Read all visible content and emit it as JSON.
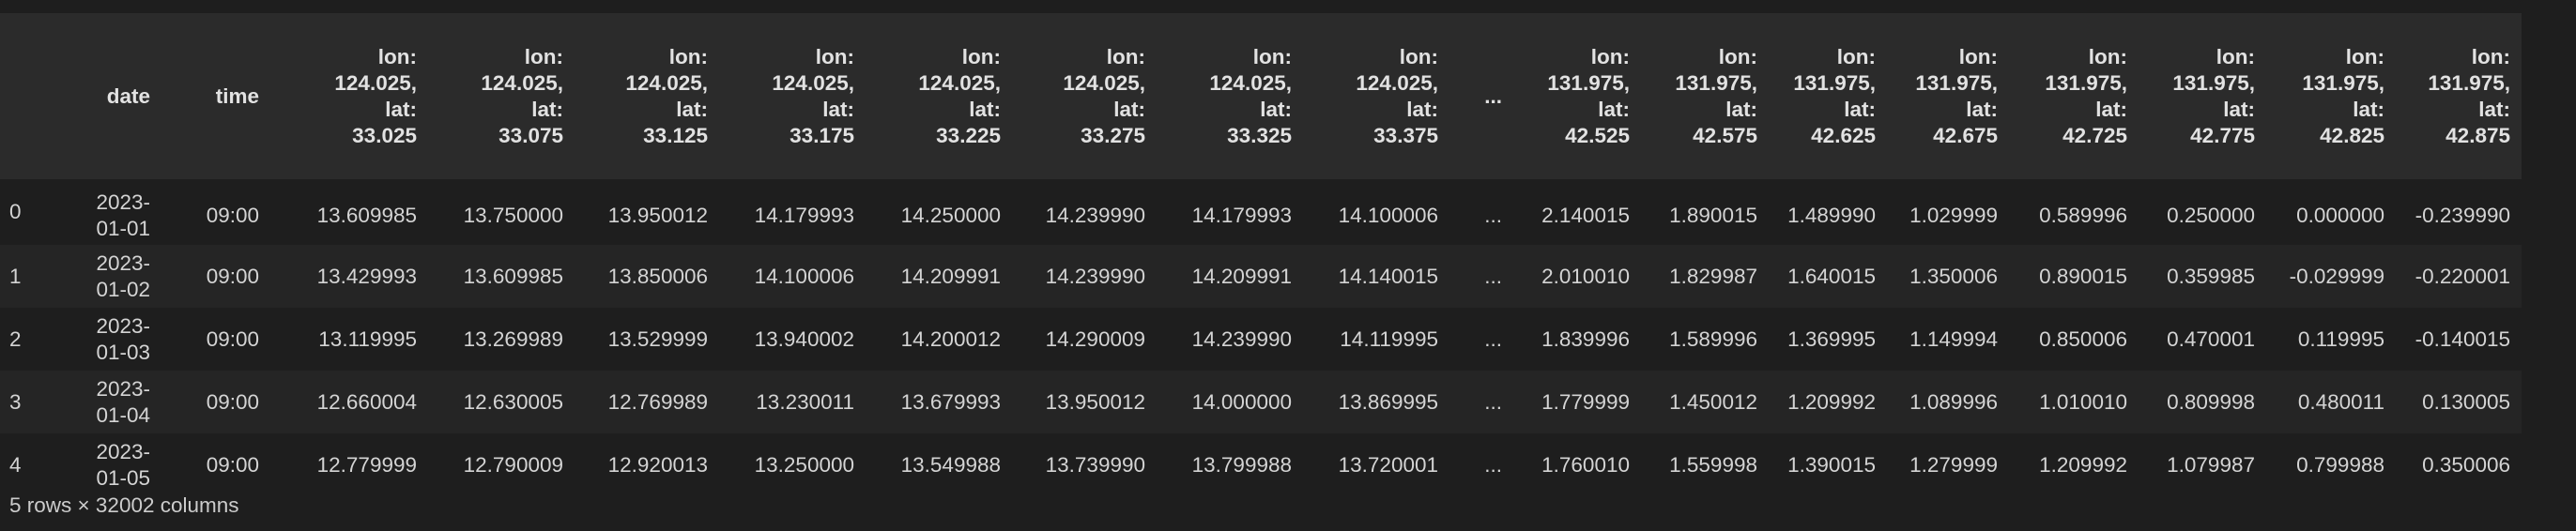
{
  "table": {
    "columns": [
      "",
      "date",
      "time",
      [
        "lon:",
        "124.025,",
        "lat:",
        "33.025"
      ],
      [
        "lon:",
        "124.025,",
        "lat:",
        "33.075"
      ],
      [
        "lon:",
        "124.025,",
        "lat:",
        "33.125"
      ],
      [
        "lon:",
        "124.025,",
        "lat:",
        "33.175"
      ],
      [
        "lon:",
        "124.025,",
        "lat:",
        "33.225"
      ],
      [
        "lon:",
        "124.025,",
        "lat:",
        "33.275"
      ],
      [
        "lon:",
        "124.025,",
        "lat:",
        "33.325"
      ],
      [
        "lon:",
        "124.025,",
        "lat:",
        "33.375"
      ],
      "...",
      [
        "lon:",
        "131.975,",
        "lat:",
        "42.525"
      ],
      [
        "lon:",
        "131.975,",
        "lat:",
        "42.575"
      ],
      [
        "lon:",
        "131.975,",
        "lat:",
        "42.625"
      ],
      [
        "lon:",
        "131.975,",
        "lat:",
        "42.675"
      ],
      [
        "lon:",
        "131.975,",
        "lat:",
        "42.725"
      ],
      [
        "lon:",
        "131.975,",
        "lat:",
        "42.775"
      ],
      [
        "lon:",
        "131.975,",
        "lat:",
        "42.825"
      ],
      [
        "lon:",
        "131.975,",
        "lat:",
        "42.875"
      ]
    ],
    "rows": [
      {
        "index": "0",
        "date": [
          "2023-",
          "01-01"
        ],
        "time": "09:00",
        "values": [
          "13.609985",
          "13.750000",
          "13.950012",
          "14.179993",
          "14.250000",
          "14.239990",
          "14.179993",
          "14.100006",
          "...",
          "2.140015",
          "1.890015",
          "1.489990",
          "1.029999",
          "0.589996",
          "0.250000",
          "0.000000",
          "-0.239990"
        ]
      },
      {
        "index": "1",
        "date": [
          "2023-",
          "01-02"
        ],
        "time": "09:00",
        "values": [
          "13.429993",
          "13.609985",
          "13.850006",
          "14.100006",
          "14.209991",
          "14.239990",
          "14.209991",
          "14.140015",
          "...",
          "2.010010",
          "1.829987",
          "1.640015",
          "1.350006",
          "0.890015",
          "0.359985",
          "-0.029999",
          "-0.220001"
        ]
      },
      {
        "index": "2",
        "date": [
          "2023-",
          "01-03"
        ],
        "time": "09:00",
        "values": [
          "13.119995",
          "13.269989",
          "13.529999",
          "13.940002",
          "14.200012",
          "14.290009",
          "14.239990",
          "14.119995",
          "...",
          "1.839996",
          "1.589996",
          "1.369995",
          "1.149994",
          "0.850006",
          "0.470001",
          "0.119995",
          "-0.140015"
        ]
      },
      {
        "index": "3",
        "date": [
          "2023-",
          "01-04"
        ],
        "time": "09:00",
        "values": [
          "12.660004",
          "12.630005",
          "12.769989",
          "13.230011",
          "13.679993",
          "13.950012",
          "14.000000",
          "13.869995",
          "...",
          "1.779999",
          "1.450012",
          "1.209992",
          "1.089996",
          "1.010010",
          "0.809998",
          "0.480011",
          "0.130005"
        ]
      },
      {
        "index": "4",
        "date": [
          "2023-",
          "01-05"
        ],
        "time": "09:00",
        "values": [
          "12.779999",
          "12.790009",
          "12.920013",
          "13.250000",
          "13.549988",
          "13.739990",
          "13.799988",
          "13.720001",
          "...",
          "1.760010",
          "1.559998",
          "1.390015",
          "1.279999",
          "1.209992",
          "1.079987",
          "0.799988",
          "0.350006"
        ]
      }
    ]
  },
  "footer": {
    "shape_text": "5 rows × 32002 columns"
  }
}
